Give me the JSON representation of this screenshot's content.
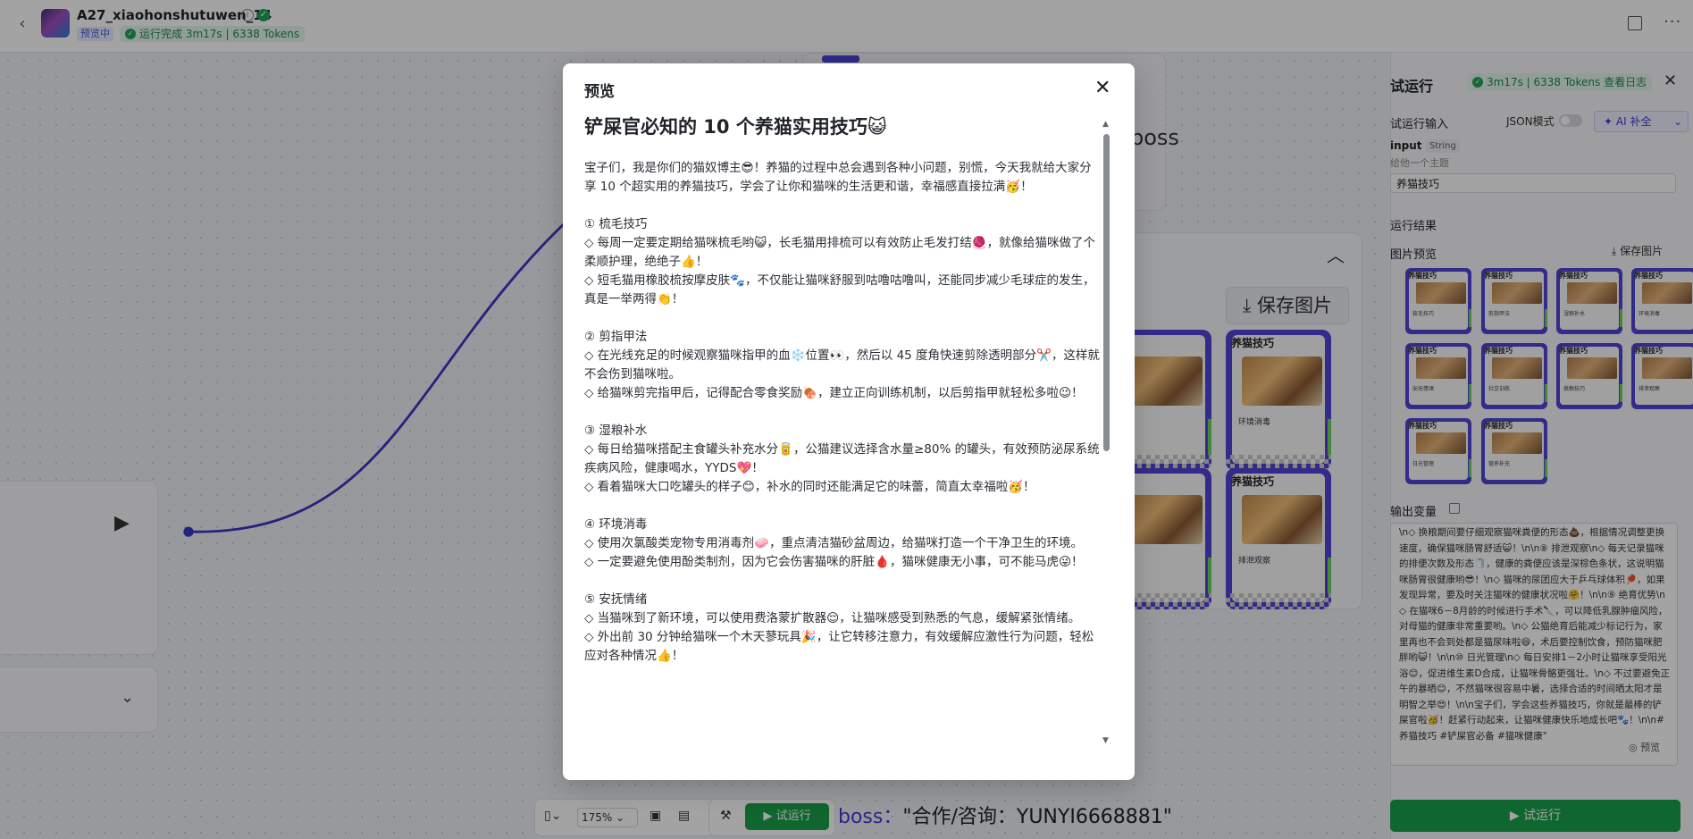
{
  "app": {
    "title": "A27_xiaohonshutuwen_14",
    "badge": "预览中",
    "run_status": "运行完成 3m17s | 6338 Tokens",
    "back_glyph": "‹",
    "more_glyph": "···"
  },
  "canvas": {
    "zoom": "175%",
    "run_label": "试运行",
    "save_image_label": "保存图片",
    "boss_top": "boss",
    "boss_key": "boss：",
    "boss_value": "\"合作/咨询：YUNYI6668881\"",
    "card_title": "养猫技巧",
    "card_captions": [
      "环境消毒",
      "排泄观察"
    ]
  },
  "right_panel": {
    "title": "试运行",
    "status": "3m17s | 6338 Tokens  查看日志",
    "input_section": "试运行输入",
    "json_mode": "JSON模式",
    "ai_fill": "AI 补全",
    "input_name": "input",
    "input_type": "String",
    "input_hint": "给他一个主题",
    "input_value": "养猫技巧",
    "result_section": "运行结果",
    "image_preview": "图片预览",
    "save_image": "保存图片",
    "thumb_title": "养猫技巧",
    "thumb_captions": [
      "梳毛技巧",
      "剪指甲法",
      "湿粮补水",
      "环境消毒",
      "安抚情绪",
      "社交训练",
      "换粮技巧",
      "排泄观察",
      "日光管理",
      "营养补充"
    ],
    "output_var": "输出变量",
    "output_text": "\\n◇ 换粮期间要仔细观察猫咪粪便的形态💩，根据情况调整更换速度，确保猫咪肠胃舒适😺！\\n\\n⑧ 排泄观察\\n◇ 每天记录猫咪的排便次数及形态🧻，健康的粪便应该是深棕色条状，这说明猫咪肠胃很健康哟😎！\\n◇ 猫咪的尿团应大于乒乓球体积🏓，如果发现异常，要及时关注猫咪的健康状况啦🤗！\\n\\n⑨ 绝育优势\\n◇ 在猫咪6－8月龄的时候进行手术🔪，可以降低乳腺肿瘤风险，对母猫的健康非常重要哟。\\n◇ 公猫绝育后能减少标记行为，家里再也不会到处都是猫尿味啦😄，术后要控制饮食，预防猫咪肥胖哟😺！\\n\\n⑩ 日光管理\\n◇ 每日安排1－2小时让猫咪享受阳光浴😊，促进维生素D合成，让猫咪骨骼更强壮。\\n◇ 不过要避免正午的暴晒😊，不然猫咪很容易中暑，选择合适的时间晒太阳才是明智之举😍！\\n\\n宝子们，学会这些养猫技巧，你就是最棒的铲屎官啦🥳！赶紧行动起来，让猫咪健康快乐地成长吧🐾！\\n\\n#养猫技巧 #铲屎官必备 #猫咪健康\"",
    "output_preview": "◎ 预览",
    "run_button": "试运行"
  },
  "modal": {
    "title": "预览",
    "close_glyph": "✕",
    "heading": "铲屎官必知的 10 个养猫实用技巧😺",
    "paragraphs": [
      "宝子们，我是你们的猫奴博主😎！养猫的过程中总会遇到各种小问题，别慌，今天我就给大家分享 10 个超实用的养猫技巧，学会了让你和猫咪的生活更和谐，幸福感直接拉满🥳！",
      "",
      "① 梳毛技巧",
      "◇ 每周一定要定期给猫咪梳毛哟😺，长毛猫用排梳可以有效防止毛发打结🧶，就像给猫咪做了个柔顺护理，绝绝子👍！",
      "◇ 短毛猫用橡胶梳按摩皮肤🐾，不仅能让猫咪舒服到咕噜咕噜叫，还能同步减少毛球症的发生，真是一举两得👏！",
      "",
      "② 剪指甲法",
      "◇ 在光线充足的时候观察猫咪指甲的血❄️位置👀，然后以 45 度角快速剪除透明部分✂️，这样就不会伤到猫咪啦。",
      "◇ 给猫咪剪完指甲后，记得配合零食奖励🍖，建立正向训练机制，以后剪指甲就轻松多啦😉！",
      "",
      "③ 湿粮补水",
      "◇ 每日给猫咪搭配主食罐头补充水分🥫，公猫建议选择含水量≥80% 的罐头，有效预防泌尿系统疾病风险，健康喝水，YYDS💖！",
      "◇ 看着猫咪大口吃罐头的样子😊，补水的同时还能满足它的味蕾，简直太幸福啦🥳！",
      "",
      "④ 环境消毒",
      "◇ 使用次氯酸类宠物专用消毒剂🧼，重点清洁猫砂盆周边，给猫咪打造一个干净卫生的环境。",
      "◇ 一定要避免使用酚类制剂，因为它会伤害猫咪的肝脏🩸，猫咪健康无小事，可不能马虎😜！",
      "",
      "⑤ 安抚情绪",
      "◇ 当猫咪到了新环境，可以使用费洛蒙扩散器😌，让猫咪感受到熟悉的气息，缓解紧张情绪。",
      "◇ 外出前 30 分钟给猫咪一个木天蓼玩具🎉，让它转移注意力，有效缓解应激性行为问题，轻松应对各种情况👍！"
    ]
  }
}
